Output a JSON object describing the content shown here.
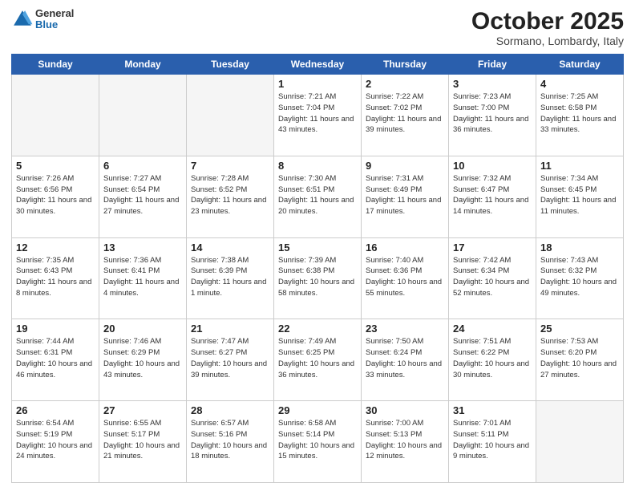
{
  "header": {
    "logo_general": "General",
    "logo_blue": "Blue",
    "title": "October 2025",
    "location": "Sormano, Lombardy, Italy"
  },
  "weekdays": [
    "Sunday",
    "Monday",
    "Tuesday",
    "Wednesday",
    "Thursday",
    "Friday",
    "Saturday"
  ],
  "weeks": [
    [
      {
        "day": "",
        "info": ""
      },
      {
        "day": "",
        "info": ""
      },
      {
        "day": "",
        "info": ""
      },
      {
        "day": "1",
        "info": "Sunrise: 7:21 AM\nSunset: 7:04 PM\nDaylight: 11 hours\nand 43 minutes."
      },
      {
        "day": "2",
        "info": "Sunrise: 7:22 AM\nSunset: 7:02 PM\nDaylight: 11 hours\nand 39 minutes."
      },
      {
        "day": "3",
        "info": "Sunrise: 7:23 AM\nSunset: 7:00 PM\nDaylight: 11 hours\nand 36 minutes."
      },
      {
        "day": "4",
        "info": "Sunrise: 7:25 AM\nSunset: 6:58 PM\nDaylight: 11 hours\nand 33 minutes."
      }
    ],
    [
      {
        "day": "5",
        "info": "Sunrise: 7:26 AM\nSunset: 6:56 PM\nDaylight: 11 hours\nand 30 minutes."
      },
      {
        "day": "6",
        "info": "Sunrise: 7:27 AM\nSunset: 6:54 PM\nDaylight: 11 hours\nand 27 minutes."
      },
      {
        "day": "7",
        "info": "Sunrise: 7:28 AM\nSunset: 6:52 PM\nDaylight: 11 hours\nand 23 minutes."
      },
      {
        "day": "8",
        "info": "Sunrise: 7:30 AM\nSunset: 6:51 PM\nDaylight: 11 hours\nand 20 minutes."
      },
      {
        "day": "9",
        "info": "Sunrise: 7:31 AM\nSunset: 6:49 PM\nDaylight: 11 hours\nand 17 minutes."
      },
      {
        "day": "10",
        "info": "Sunrise: 7:32 AM\nSunset: 6:47 PM\nDaylight: 11 hours\nand 14 minutes."
      },
      {
        "day": "11",
        "info": "Sunrise: 7:34 AM\nSunset: 6:45 PM\nDaylight: 11 hours\nand 11 minutes."
      }
    ],
    [
      {
        "day": "12",
        "info": "Sunrise: 7:35 AM\nSunset: 6:43 PM\nDaylight: 11 hours\nand 8 minutes."
      },
      {
        "day": "13",
        "info": "Sunrise: 7:36 AM\nSunset: 6:41 PM\nDaylight: 11 hours\nand 4 minutes."
      },
      {
        "day": "14",
        "info": "Sunrise: 7:38 AM\nSunset: 6:39 PM\nDaylight: 11 hours\nand 1 minute."
      },
      {
        "day": "15",
        "info": "Sunrise: 7:39 AM\nSunset: 6:38 PM\nDaylight: 10 hours\nand 58 minutes."
      },
      {
        "day": "16",
        "info": "Sunrise: 7:40 AM\nSunset: 6:36 PM\nDaylight: 10 hours\nand 55 minutes."
      },
      {
        "day": "17",
        "info": "Sunrise: 7:42 AM\nSunset: 6:34 PM\nDaylight: 10 hours\nand 52 minutes."
      },
      {
        "day": "18",
        "info": "Sunrise: 7:43 AM\nSunset: 6:32 PM\nDaylight: 10 hours\nand 49 minutes."
      }
    ],
    [
      {
        "day": "19",
        "info": "Sunrise: 7:44 AM\nSunset: 6:31 PM\nDaylight: 10 hours\nand 46 minutes."
      },
      {
        "day": "20",
        "info": "Sunrise: 7:46 AM\nSunset: 6:29 PM\nDaylight: 10 hours\nand 43 minutes."
      },
      {
        "day": "21",
        "info": "Sunrise: 7:47 AM\nSunset: 6:27 PM\nDaylight: 10 hours\nand 39 minutes."
      },
      {
        "day": "22",
        "info": "Sunrise: 7:49 AM\nSunset: 6:25 PM\nDaylight: 10 hours\nand 36 minutes."
      },
      {
        "day": "23",
        "info": "Sunrise: 7:50 AM\nSunset: 6:24 PM\nDaylight: 10 hours\nand 33 minutes."
      },
      {
        "day": "24",
        "info": "Sunrise: 7:51 AM\nSunset: 6:22 PM\nDaylight: 10 hours\nand 30 minutes."
      },
      {
        "day": "25",
        "info": "Sunrise: 7:53 AM\nSunset: 6:20 PM\nDaylight: 10 hours\nand 27 minutes."
      }
    ],
    [
      {
        "day": "26",
        "info": "Sunrise: 6:54 AM\nSunset: 5:19 PM\nDaylight: 10 hours\nand 24 minutes."
      },
      {
        "day": "27",
        "info": "Sunrise: 6:55 AM\nSunset: 5:17 PM\nDaylight: 10 hours\nand 21 minutes."
      },
      {
        "day": "28",
        "info": "Sunrise: 6:57 AM\nSunset: 5:16 PM\nDaylight: 10 hours\nand 18 minutes."
      },
      {
        "day": "29",
        "info": "Sunrise: 6:58 AM\nSunset: 5:14 PM\nDaylight: 10 hours\nand 15 minutes."
      },
      {
        "day": "30",
        "info": "Sunrise: 7:00 AM\nSunset: 5:13 PM\nDaylight: 10 hours\nand 12 minutes."
      },
      {
        "day": "31",
        "info": "Sunrise: 7:01 AM\nSunset: 5:11 PM\nDaylight: 10 hours\nand 9 minutes."
      },
      {
        "day": "",
        "info": ""
      }
    ]
  ]
}
